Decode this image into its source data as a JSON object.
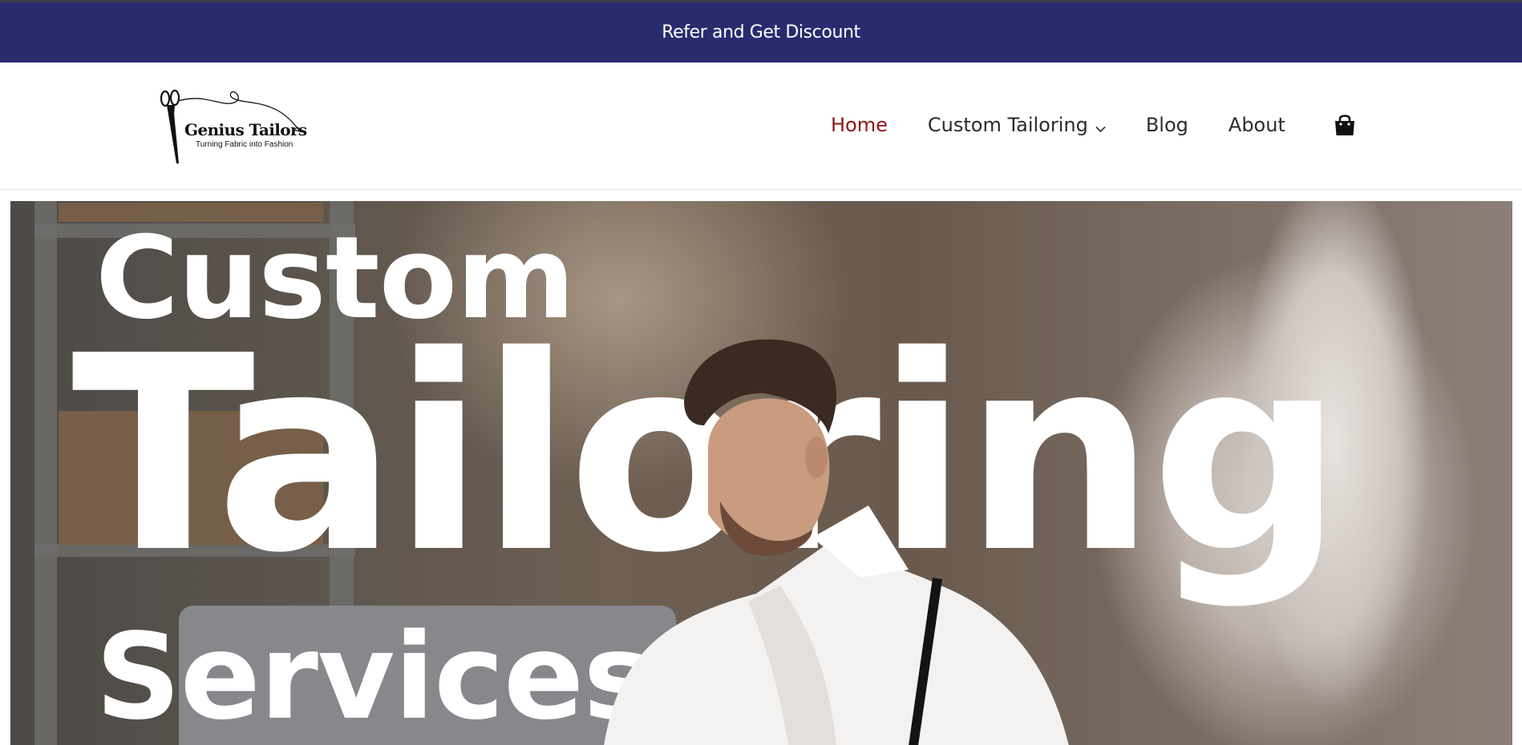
{
  "announcement": {
    "text": "Refer and Get Discount"
  },
  "logo": {
    "brand": "Genius Tailors",
    "tagline": "Turning Fabric into Fashion"
  },
  "nav": {
    "items": [
      {
        "label": "Home",
        "active": true
      },
      {
        "label": "Custom Tailoring",
        "has_dropdown": true
      },
      {
        "label": "Blog"
      },
      {
        "label": "About"
      }
    ],
    "cart_icon": "shopping-bag-icon"
  },
  "hero": {
    "line1": "Custom",
    "line2": "Tailoring",
    "line3": "Services"
  },
  "colors": {
    "announcement_bg": "#282c6e",
    "active_nav": "#8e1418",
    "nav_text": "#2b2b2b"
  }
}
